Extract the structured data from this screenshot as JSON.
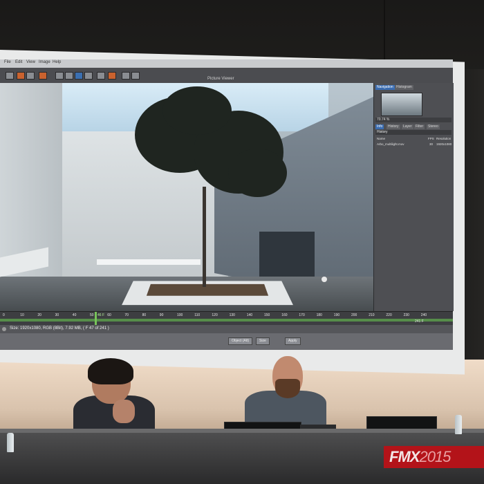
{
  "app": {
    "window_title": "Picture Viewer",
    "menu": [
      "File",
      "Edit",
      "View",
      "Image",
      "Help"
    ],
    "side_panel": {
      "tabs_top": [
        "Navigation",
        "Histogram"
      ],
      "zoom_label": "70.74 %",
      "tabs_mid": [
        "Info",
        "History",
        "Layer",
        "Filter",
        "Stereo"
      ],
      "history_title": "History",
      "history_headers": [
        "Name",
        "FPS",
        "Resolution"
      ],
      "history_rows": [
        {
          "name": "Arbo_multilight.mov",
          "fps": "30",
          "res": "1920x1080"
        }
      ]
    },
    "timeline": {
      "ticks": [
        "0",
        "10",
        "20",
        "30",
        "40",
        "50",
        "60",
        "70",
        "80",
        "90",
        "100",
        "110",
        "120",
        "130",
        "140",
        "150",
        "160",
        "170",
        "180",
        "190",
        "200",
        "210",
        "220",
        "230",
        "240"
      ],
      "current_frame": "46 F",
      "end_frame": "241 F"
    },
    "status": "Size: 1920x1080, RGB (8Bit), 7.92 MB,  ( F 47 of 241 )",
    "controls": {
      "object": "Object (Alt)",
      "size": "Size",
      "apply": "Apply"
    }
  },
  "sign": {
    "brand": "FMX",
    "year": "2015",
    "color": "#b31319"
  },
  "people": [
    {
      "label": "panelist-left"
    },
    {
      "label": "panelist-right"
    }
  ]
}
